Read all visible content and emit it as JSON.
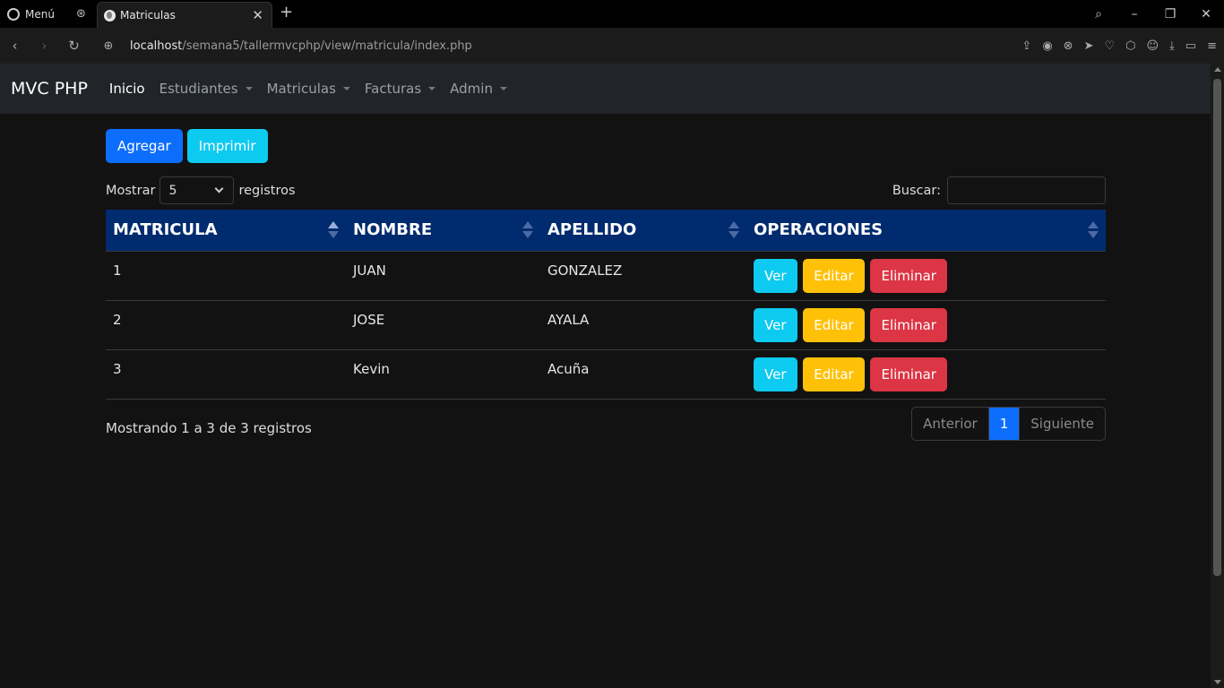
{
  "browser": {
    "menu_label": "Menú",
    "tab_title": "Matriculas",
    "url_host": "localhost",
    "url_path": "/semana5/tallermvcphp/view/matricula/index.php"
  },
  "navbar": {
    "brand": "MVC PHP",
    "items": [
      {
        "label": "Inicio",
        "active": true
      },
      {
        "label": "Estudiantes",
        "dropdown": true
      },
      {
        "label": "Matriculas",
        "dropdown": true
      },
      {
        "label": "Facturas",
        "dropdown": true
      },
      {
        "label": "Admin",
        "dropdown": true
      }
    ]
  },
  "actions": {
    "add_label": "Agregar",
    "print_label": "Imprimir"
  },
  "length": {
    "prefix": "Mostrar",
    "value": "5",
    "suffix": "registros"
  },
  "search": {
    "label": "Buscar:",
    "value": ""
  },
  "table": {
    "headers": [
      "MATRICULA",
      "NOMBRE",
      "APELLIDO",
      "OPERACIONES"
    ],
    "rows": [
      {
        "matricula": "1",
        "nombre": "JUAN",
        "apellido": "GONZALEZ"
      },
      {
        "matricula": "2",
        "nombre": "JOSE",
        "apellido": "AYALA"
      },
      {
        "matricula": "3",
        "nombre": "Kevin",
        "apellido": "Acuña"
      }
    ],
    "op_view": "Ver",
    "op_edit": "Editar",
    "op_delete": "Eliminar"
  },
  "footer": {
    "info": "Mostrando 1 a 3 de 3 registros",
    "prev": "Anterior",
    "current_page": "1",
    "next": "Siguiente"
  }
}
